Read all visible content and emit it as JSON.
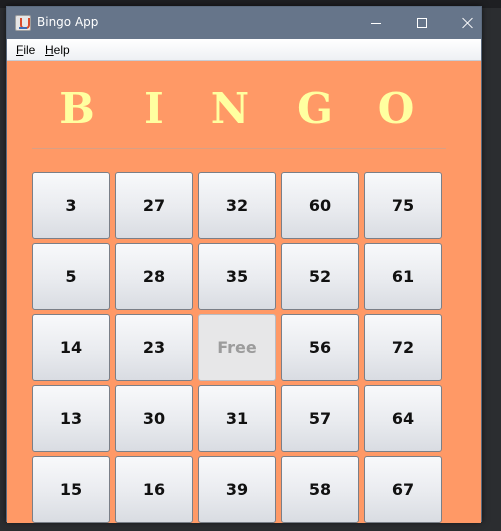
{
  "window": {
    "title": "Bingo App",
    "controls": {
      "minimize_icon": "minimize-icon",
      "maximize_icon": "maximize-icon",
      "close_icon": "close-icon"
    }
  },
  "menu": {
    "file_accel": "F",
    "file_rest": "ile",
    "help_accel": "H",
    "help_rest": "elp"
  },
  "header": {
    "letters": [
      "B",
      "I",
      "N",
      "G",
      "O"
    ]
  },
  "board": {
    "rows": [
      [
        "3",
        "27",
        "32",
        "60",
        "75"
      ],
      [
        "5",
        "28",
        "35",
        "52",
        "61"
      ],
      [
        "14",
        "23",
        "Free",
        "56",
        "72"
      ],
      [
        "13",
        "30",
        "31",
        "57",
        "64"
      ],
      [
        "15",
        "16",
        "39",
        "58",
        "67"
      ]
    ],
    "free_cell": {
      "row": 2,
      "col": 2
    }
  },
  "colors": {
    "background": "#ff9966",
    "title_bar": "#66758a",
    "letters": "#ffffa0"
  }
}
